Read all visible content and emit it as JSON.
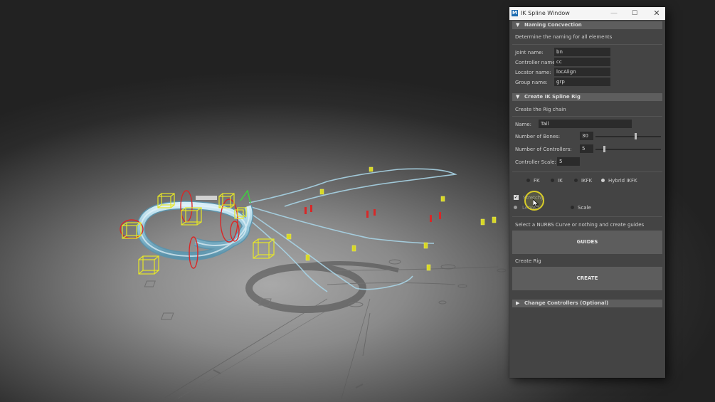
{
  "window": {
    "title": "IK Spline Window",
    "app_icon": "M",
    "minimize_glyph": "—",
    "maximize_glyph": "☐",
    "close_glyph": "✕"
  },
  "naming": {
    "header": "Naming Concvection",
    "description": "Determine the naming for all elements",
    "joint_label": "Joint name:",
    "joint_value": "bn",
    "controller_label": "Controller name:",
    "controller_value": "cc",
    "locator_label": "Locator name:",
    "locator_value": "locAlign",
    "group_label": "Group name:",
    "group_value": "grp"
  },
  "rig": {
    "header": "Create IK Spline Rig",
    "description": "Create the Rig chain",
    "name_label": "Name:",
    "name_value": "Tail",
    "bones_label": "Number of Bones:",
    "bones_value": "30",
    "bones_slider_fraction": 0.6,
    "controllers_label": "Number of Controllers:",
    "controllers_value": "5",
    "controllers_slider_fraction": 0.12,
    "scale_label": "Controller Scale:",
    "scale_value": "5",
    "rig_type_options": [
      "FK",
      "IK",
      "IKFK",
      "Hybrid IKFK"
    ],
    "rig_type_selected": "Hybrid IKFK",
    "stretchy_label": "Stretchy",
    "stretchy_checked": true,
    "stretch_mode_first_label": "Length",
    "stretch_mode_second_label": "Scale",
    "guides_description": "Select a NURBS Curve or nothing and create guides",
    "guides_button": "GUIDES",
    "create_description": "Create Rig",
    "create_button": "CREATE"
  },
  "change_controllers": {
    "header": "Change Controllers (Optional)"
  },
  "icons": {
    "expanded": "triangle-down",
    "collapsed": "triangle-right",
    "cursor": "arrow-cursor"
  },
  "colors": {
    "panel_bg": "#444444",
    "section_header_bg": "#5e5e5e",
    "field_bg": "#2b2b2b",
    "button_bg": "#5d5d5d",
    "controller_yellow": "#e6e628",
    "controller_red": "#d82828",
    "curve_blue": "#a8d4e6"
  }
}
